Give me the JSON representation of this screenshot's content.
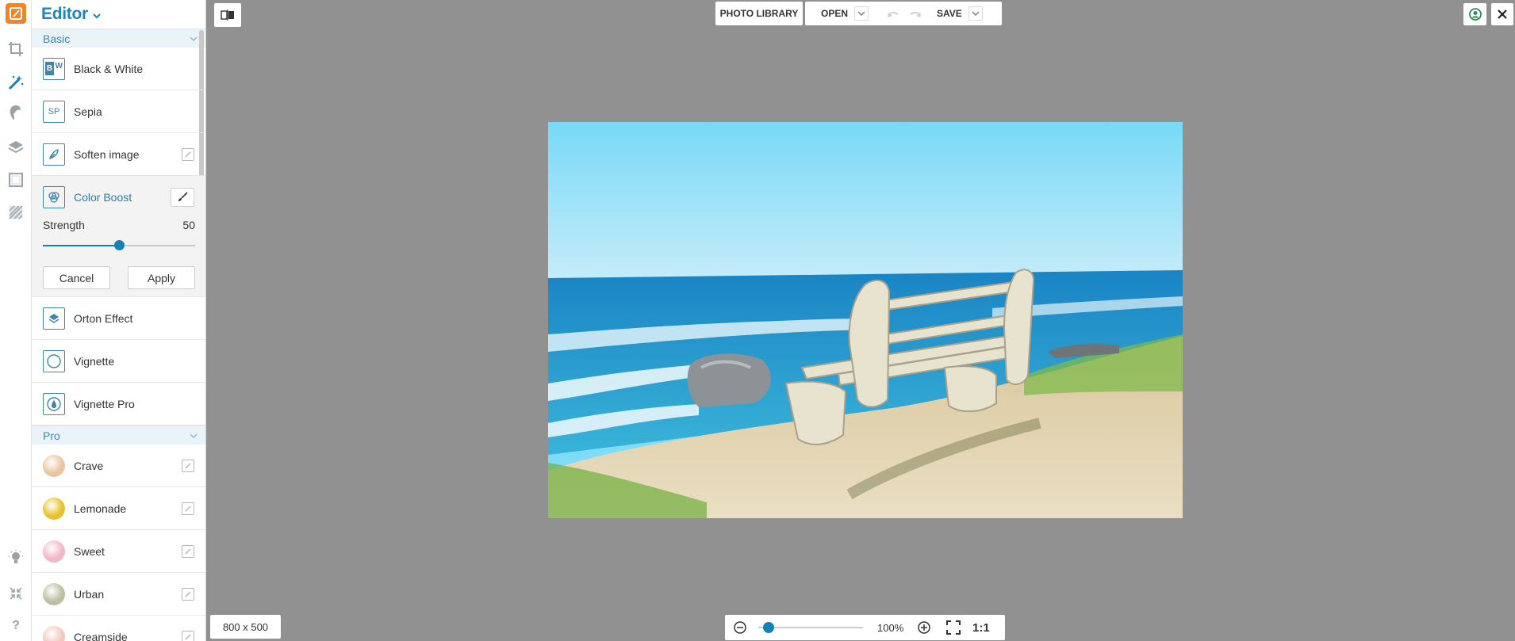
{
  "panel": {
    "title": "Editor"
  },
  "sections": {
    "basic": "Basic",
    "pro": "Pro"
  },
  "basic_items": [
    {
      "label": "Black & White",
      "icon_text": "BW"
    },
    {
      "label": "Sepia",
      "icon_text": "SP"
    },
    {
      "label": "Soften image"
    },
    {
      "label": "Color Boost"
    },
    {
      "label": "Orton Effect"
    },
    {
      "label": "Vignette"
    },
    {
      "label": "Vignette Pro"
    }
  ],
  "color_boost": {
    "strength_label": "Strength",
    "strength_value": "50",
    "strength_fraction": 0.5,
    "cancel_label": "Cancel",
    "apply_label": "Apply"
  },
  "pro_items": [
    {
      "label": "Crave",
      "color": "#e9c6a0"
    },
    {
      "label": "Lemonade",
      "color": "#e8c22a"
    },
    {
      "label": "Sweet",
      "color": "#f3b6c9"
    },
    {
      "label": "Urban",
      "color": "#bdbfa0"
    },
    {
      "label": "Creamside",
      "color": "#f2c9b9"
    }
  ],
  "toolbar": {
    "photo_library": "PHOTO LIBRARY",
    "open": "OPEN",
    "save": "SAVE"
  },
  "footer": {
    "dimensions": "800 x 500",
    "zoom_percent": "100%",
    "zoom_fraction": 0.1,
    "ratio": "1:1"
  },
  "colors": {
    "accent": "#1581b5",
    "logo": "#f0842a",
    "workspace": "#919191"
  }
}
